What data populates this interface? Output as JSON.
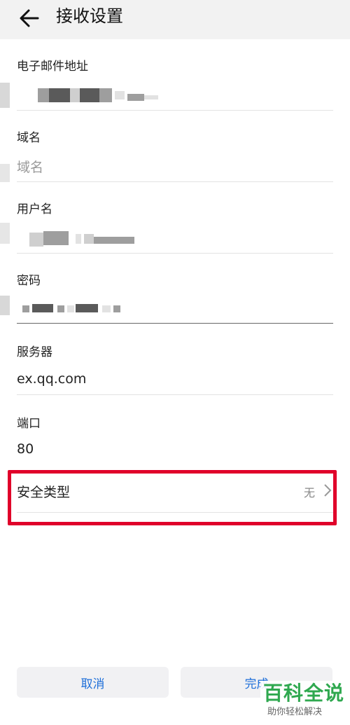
{
  "header": {
    "title": "接收设置"
  },
  "fields": {
    "email": {
      "label": "电子邮件地址",
      "value": ""
    },
    "domain": {
      "label": "域名",
      "placeholder": "域名"
    },
    "username": {
      "label": "用户名",
      "value": ""
    },
    "password": {
      "label": "密码",
      "value": ""
    },
    "server": {
      "label": "服务器",
      "value": "ex.qq.com"
    },
    "port": {
      "label": "端口",
      "value": "80"
    }
  },
  "security": {
    "label": "安全类型",
    "value": "无"
  },
  "buttons": {
    "cancel": "取消",
    "done": "完成"
  },
  "watermark": {
    "title": "百科全说",
    "subtitle": "助你轻松解决"
  },
  "colors": {
    "accent": "#1e6fd9",
    "highlight": "#e0002a",
    "watermark": "#2fa84f"
  }
}
